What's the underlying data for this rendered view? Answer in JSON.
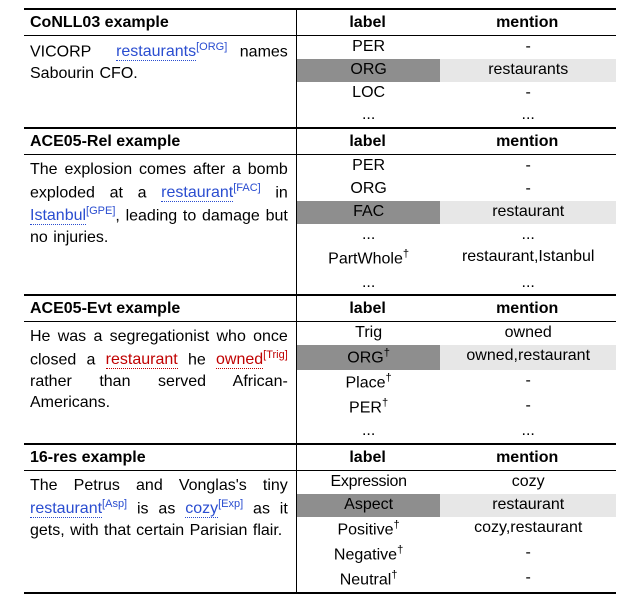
{
  "sections": [
    {
      "name": "CoNLL03 example",
      "label_h": "label",
      "mention_h": "mention",
      "example_html": "VICORP &nbsp;<span class='ann'>restaurants</span><span class='tag tagB'>[ORG]</span> names Sabourin CFO.",
      "rows": [
        {
          "label": "PER",
          "mention": "-",
          "hl": false
        },
        {
          "label": "ORG",
          "mention": "restaurants",
          "hl": true
        },
        {
          "label": "LOC",
          "mention": "-",
          "hl": false
        },
        {
          "label": "...",
          "mention": "...",
          "hl": false
        }
      ]
    },
    {
      "name": "ACE05-Rel example",
      "label_h": "label",
      "mention_h": "mention",
      "example_html": "The explosion comes after a bomb exploded at a <span class='ann'>restaurant</span><span class='tag tagB'>[FAC]</span> in <span class='ann'>Istanbul</span><span class='tag tagB'>[GPE]</span>, leading to damage but no injuries.",
      "rows": [
        {
          "label": "PER",
          "mention": "-",
          "hl": false
        },
        {
          "label": "ORG",
          "mention": "-",
          "hl": false
        },
        {
          "label": "FAC",
          "mention": "restaurant",
          "hl": true
        },
        {
          "label": "...",
          "mention": "...",
          "hl": false
        },
        {
          "label": "PartWhole<sup class='dag'>†</sup>",
          "mention": "restaurant,Istanbul",
          "hl": false
        },
        {
          "label": "...",
          "mention": "...",
          "hl": false
        }
      ]
    },
    {
      "name": "ACE05-Evt example",
      "label_h": "label",
      "mention_h": "mention",
      "example_html": "He was a segregationist who once closed a <span class='annR'>restaurant</span> he <span class='annR'>owned</span><span class='tag tagR'>[Trig]</span> rather than served African-Americans.",
      "rows": [
        {
          "label": "Trig",
          "mention": "owned",
          "hl": false
        },
        {
          "label": "ORG<sup class='dag'>†</sup>",
          "mention": "owned,restaurant",
          "hl": true
        },
        {
          "label": "Place<sup class='dag'>†</sup>",
          "mention": "-",
          "hl": false
        },
        {
          "label": "PER<sup class='dag'>†</sup>",
          "mention": "-",
          "hl": false
        },
        {
          "label": "...",
          "mention": "...",
          "hl": false
        }
      ]
    },
    {
      "name": "16-res example",
      "label_h": "label",
      "mention_h": "mention",
      "example_html": "The Petrus and Vonglas's tiny <span class='ann'>restaurant</span><span class='tag tagB'>[Asp]</span> is as <span class='ann'>cozy</span><span class='tag tagB'>[Exp]</span> as it gets, with that certain Parisian flair.",
      "rows": [
        {
          "label": "<span class='labelWide'>Expression</span>",
          "mention": "cozy",
          "hl": false
        },
        {
          "label": "Aspect",
          "mention": "restaurant",
          "hl": true
        },
        {
          "label": "Positive<sup class='dag'>†</sup>",
          "mention": "cozy,restaurant",
          "hl": false
        },
        {
          "label": "Negative<sup class='dag'>†</sup>",
          "mention": "-",
          "hl": false
        },
        {
          "label": "Neutral<sup class='dag'>†</sup>",
          "mention": "-",
          "hl": false
        }
      ]
    }
  ],
  "chart_data": {
    "type": "table",
    "sections": [
      {
        "dataset": "CoNLL03",
        "sentence": "VICORP restaurants[ORG] names Sabourin CFO.",
        "annotations": [
          {
            "span": "restaurants",
            "tag": "ORG"
          }
        ],
        "table": [
          {
            "label": "PER",
            "mention": "-"
          },
          {
            "label": "ORG",
            "mention": "restaurants",
            "highlight": true
          },
          {
            "label": "LOC",
            "mention": "-"
          },
          {
            "label": "...",
            "mention": "..."
          }
        ]
      },
      {
        "dataset": "ACE05-Rel",
        "sentence": "The explosion comes after a bomb exploded at a restaurant[FAC] in Istanbul[GPE], leading to damage but no injuries.",
        "annotations": [
          {
            "span": "restaurant",
            "tag": "FAC"
          },
          {
            "span": "Istanbul",
            "tag": "GPE"
          }
        ],
        "table": [
          {
            "label": "PER",
            "mention": "-"
          },
          {
            "label": "ORG",
            "mention": "-"
          },
          {
            "label": "FAC",
            "mention": "restaurant",
            "highlight": true
          },
          {
            "label": "...",
            "mention": "..."
          },
          {
            "label": "PartWhole†",
            "mention": "restaurant,Istanbul"
          },
          {
            "label": "...",
            "mention": "..."
          }
        ]
      },
      {
        "dataset": "ACE05-Evt",
        "sentence": "He was a segregationist who once closed a restaurant he owned[Trig] rather than served African-Americans.",
        "annotations": [
          {
            "span": "restaurant",
            "tag": null
          },
          {
            "span": "owned",
            "tag": "Trig"
          }
        ],
        "table": [
          {
            "label": "Trig",
            "mention": "owned"
          },
          {
            "label": "ORG†",
            "mention": "owned,restaurant",
            "highlight": true
          },
          {
            "label": "Place†",
            "mention": "-"
          },
          {
            "label": "PER†",
            "mention": "-"
          },
          {
            "label": "...",
            "mention": "..."
          }
        ]
      },
      {
        "dataset": "16-res",
        "sentence": "The Petrus and Vonglas's tiny restaurant[Asp] is as cozy[Exp] as it gets, with that certain Parisian flair.",
        "annotations": [
          {
            "span": "restaurant",
            "tag": "Asp"
          },
          {
            "span": "cozy",
            "tag": "Exp"
          }
        ],
        "table": [
          {
            "label": "Expression",
            "mention": "cozy"
          },
          {
            "label": "Aspect",
            "mention": "restaurant",
            "highlight": true
          },
          {
            "label": "Positive†",
            "mention": "cozy,restaurant"
          },
          {
            "label": "Negative†",
            "mention": "-"
          },
          {
            "label": "Neutral†",
            "mention": "-"
          }
        ]
      }
    ]
  }
}
